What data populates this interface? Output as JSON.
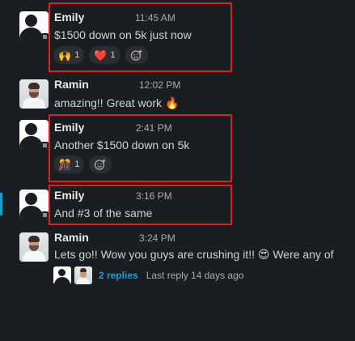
{
  "messages": [
    {
      "author": "Emily",
      "time": "11:45 AM",
      "text": "$1500 down on 5k just now",
      "reactions": [
        {
          "emoji": "🙌",
          "count": "1"
        },
        {
          "emoji": "❤️",
          "count": "1"
        }
      ]
    },
    {
      "author": "Ramin",
      "time": "12:02 PM",
      "text": "amazing!! Great work 🔥"
    },
    {
      "author": "Emily",
      "time": "2:41 PM",
      "text": "Another $1500 down on 5k",
      "reactions": [
        {
          "emoji": "🎊",
          "count": "1"
        }
      ]
    },
    {
      "author": "Emily",
      "time": "3:16 PM",
      "text": "And #3 of the same"
    },
    {
      "author": "Ramin",
      "time": "3:24 PM",
      "text": "Lets go!! Wow you guys are crushing it!! 😍 Were any of"
    }
  ],
  "thread": {
    "replies": "2 replies",
    "last_reply": "Last reply 14 days ago"
  },
  "colors": {
    "background": "#1a1d21",
    "highlight": "#e0201a",
    "link": "#1d9bd1"
  }
}
